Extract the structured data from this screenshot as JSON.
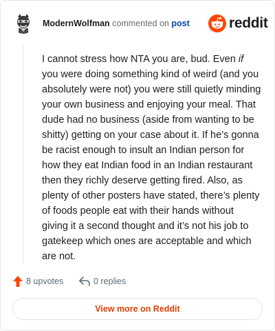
{
  "comment": {
    "author": "ModernWolfman",
    "action_text": "commented on",
    "post_link": "post",
    "brand": "reddit",
    "body_parts": {
      "before_if": "I cannot stress how NTA you are, bud. Even ",
      "if_word": "if",
      "after_if": " you were doing something kind of weird (and you absolutely were not) you were still quietly minding your own business and enjoying your meal. That dude had no business (aside from wanting to be shitty) getting on your case about it. If he’s gonna be racist enough to insult an Indian person for how they eat Indian food in an Indian restaurant then they richly deserve getting fired. Also, as plenty of other posters have stated, there’s plenty of foods people eat with their hands without giving it a second thought and it’s not his job to gatekeep which ones are acceptable and which are not."
    },
    "upvotes": "8 upvotes",
    "replies": "0 replies",
    "view_more": "View more on Reddit"
  },
  "colors": {
    "accent": "#ff4500",
    "link": "#0045ac",
    "muted": "#5c6c74"
  },
  "icons": {
    "avatar": "wolfman-avatar",
    "logo": "reddit-snoo-icon",
    "upvote": "upvote-arrow-icon",
    "reply": "reply-arrow-icon"
  }
}
